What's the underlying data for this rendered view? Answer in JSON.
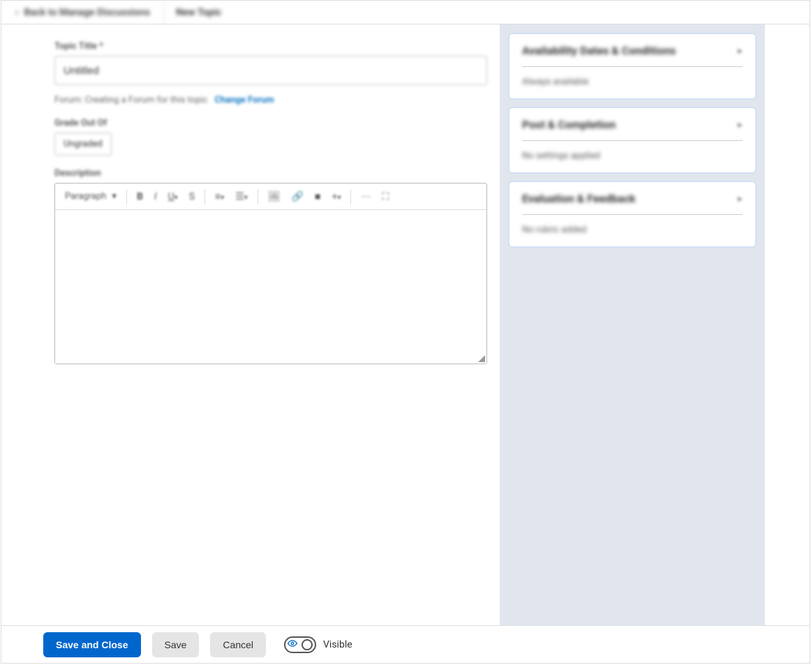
{
  "header": {
    "back_label": "Back to Manage Discussions",
    "title": "New Topic"
  },
  "main": {
    "topic_title_label": "Topic Title *",
    "topic_title_value": "Untitled",
    "forum_text": "Forum: Creating a Forum for this topic",
    "change_forum_label": "Change Forum",
    "grade_label": "Grade Out Of",
    "grade_select_label": "Ungraded",
    "description_label": "Description",
    "editor": {
      "paragraph_label": "Paragraph"
    }
  },
  "side_panels": [
    {
      "title": "Availability Dates & Conditions",
      "status": "Always available"
    },
    {
      "title": "Post & Completion",
      "status": "No settings applied"
    },
    {
      "title": "Evaluation & Feedback",
      "status": "No rubric added"
    }
  ],
  "footer": {
    "save_close_label": "Save and Close",
    "save_label": "Save",
    "cancel_label": "Cancel",
    "visibility_label": "Visible"
  }
}
